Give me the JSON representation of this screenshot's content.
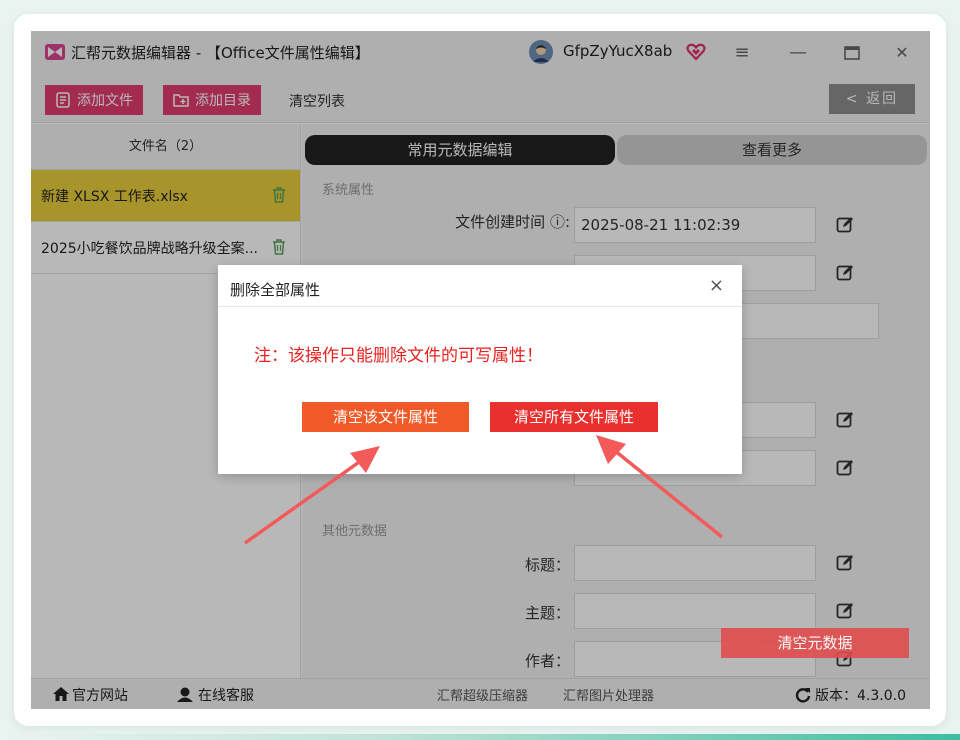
{
  "window": {
    "title": "汇帮元数据编辑器 - 【Office文件属性编辑】",
    "username": "GfpZyYucX8ab"
  },
  "toolbar": {
    "add_file": "添加文件",
    "add_folder": "添加目录",
    "clear_list": "清空列表",
    "back": "< 返回"
  },
  "file_list": {
    "header": "文件名（2）",
    "items": [
      {
        "name": "新建 XLSX 工作表.xlsx"
      },
      {
        "name": "2025小吃餐饮品牌战略升级全案..."
      }
    ]
  },
  "tabs": {
    "active": "常用元数据编辑",
    "more": "查看更多"
  },
  "form": {
    "system_section": "系统属性",
    "created_label": "文件创建时间 ⓘ:",
    "created_value": "2025-08-21 11:02:39",
    "other_section": "其他元数据",
    "title_label": "标题：",
    "subject_label": "主题：",
    "author_label": "作者：",
    "clear_meta": "清空元数据"
  },
  "status_bar": {
    "website": "官方网站",
    "support": "在线客服",
    "compressor": "汇帮超级压缩器",
    "image_tool": "汇帮图片处理器",
    "version": "版本：4.3.0.0"
  },
  "dialog": {
    "title": "删除全部属性",
    "close": "×",
    "warning": "注：该操作只能删除文件的可写属性！",
    "btn_clear_file": "清空该文件属性",
    "btn_clear_all": "清空所有文件属性"
  },
  "colors": {
    "accent_pink": "#e23c72",
    "selected_row": "#e8cd3c",
    "warning_red": "#e8231f",
    "button_orange": "#f05a28"
  }
}
